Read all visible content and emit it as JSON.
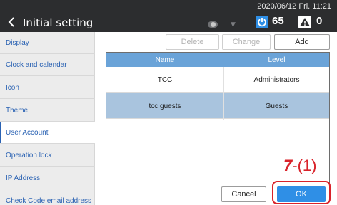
{
  "header": {
    "title": "Initial setting",
    "datetime": "2020/06/12 Fri. 11:21",
    "count_power": "65",
    "count_alert": "0",
    "icons": [
      "chevron-left-icon",
      "toggle-icon",
      "caret-down-icon",
      "power-icon",
      "warning-icon"
    ]
  },
  "sidebar": {
    "items": [
      {
        "label": "Display"
      },
      {
        "label": "Clock and calendar"
      },
      {
        "label": "Icon"
      },
      {
        "label": "Theme"
      },
      {
        "label": "User Account"
      },
      {
        "label": "Operation lock"
      },
      {
        "label": "IP Address"
      },
      {
        "label": "Check Code email address"
      }
    ],
    "active": "User Account"
  },
  "toolbar": {
    "delete_label": "Delete",
    "change_label": "Change",
    "add_label": "Add"
  },
  "table": {
    "headers": [
      "Name",
      "Level"
    ],
    "rows": [
      {
        "name": "TCC",
        "level": "Administrators"
      },
      {
        "name": "tcc guests",
        "level": "Guests"
      }
    ],
    "selected_row": "tcc guests"
  },
  "footer": {
    "cancel_label": "Cancel",
    "ok_label": "OK"
  },
  "annotation": {
    "step_number": "7",
    "step_suffix": "-(1)"
  },
  "colors": {
    "header_bg": "#2c2d2f",
    "accent_blue": "#2f8fe6",
    "table_header": "#6aa3d8",
    "selected_row": "#a9c4de",
    "annotation_red": "#d9222a",
    "sidebar_text": "#2a62b3"
  }
}
